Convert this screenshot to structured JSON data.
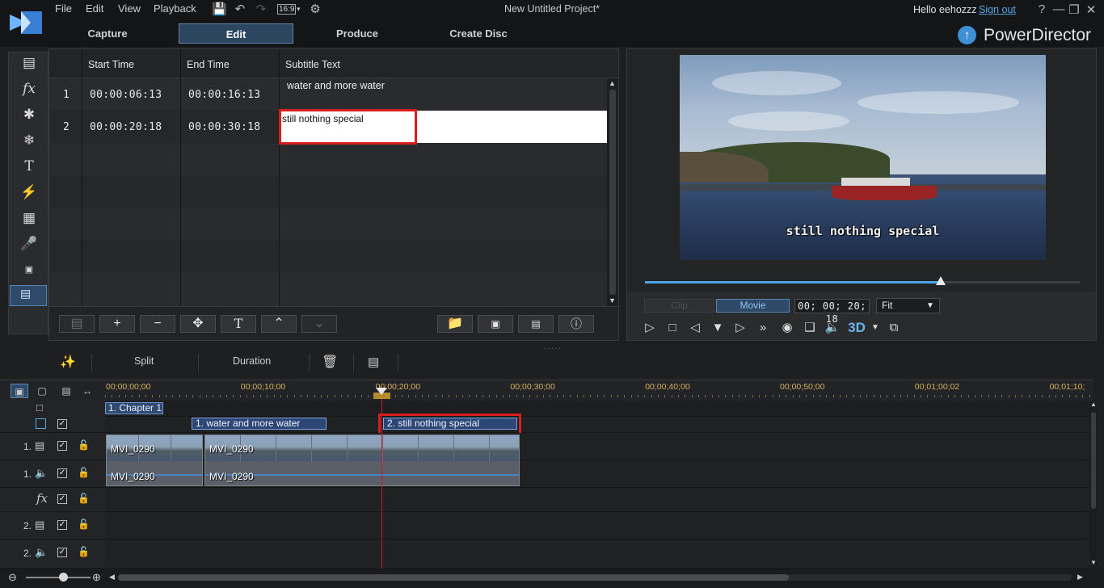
{
  "app": {
    "project_title": "New Untitled Project*",
    "brand": "PowerDirector",
    "greeting": "Hello eehozzz",
    "signout": "Sign out"
  },
  "menu": [
    "File",
    "Edit",
    "View",
    "Playback"
  ],
  "aspect_ratio": "16:9",
  "mode_tabs": [
    "Capture",
    "Edit",
    "Produce",
    "Create Disc"
  ],
  "subtitle_room": {
    "columns": [
      "Start Time",
      "End Time",
      "Subtitle Text"
    ],
    "rows": [
      {
        "index": "1",
        "start": "00:00:06:13",
        "end": "00:00:16:13",
        "text": "water and more water"
      },
      {
        "index": "2",
        "start": "00:00:20:18",
        "end": "00:00:30:18",
        "text": "still nothing special"
      }
    ]
  },
  "preview": {
    "caption": "still nothing special",
    "clip_label": "Clip",
    "movie_label": "Movie",
    "timecode": "00; 00; 20; 18",
    "fit": "Fit",
    "progress": 0.68,
    "threed": "3D"
  },
  "timeline_toolbar": {
    "split": "Split",
    "duration": "Duration"
  },
  "ruler_labels": [
    "00;00;00;00",
    "00;00;10;00",
    "00;00;20;00",
    "00;00;30;00",
    "00;00;40;00",
    "00;00;50;00",
    "00;01;00;02",
    "00;01;10;"
  ],
  "timeline": {
    "chapter": "1. Chapter 1",
    "subtitle_clips": [
      "1. water and more water",
      "2. still nothing special"
    ],
    "video_clips": [
      "MVI_0290",
      "MVI_0290"
    ],
    "audio_clips": [
      "MVI_0290",
      "MVI_0290"
    ],
    "track_numbers": [
      "1.",
      "1.",
      "2.",
      "2."
    ]
  },
  "colors": {
    "accent": "#4fa6e6",
    "highlight_red": "#d81e1e",
    "selection_blue": "#2e4a68"
  }
}
